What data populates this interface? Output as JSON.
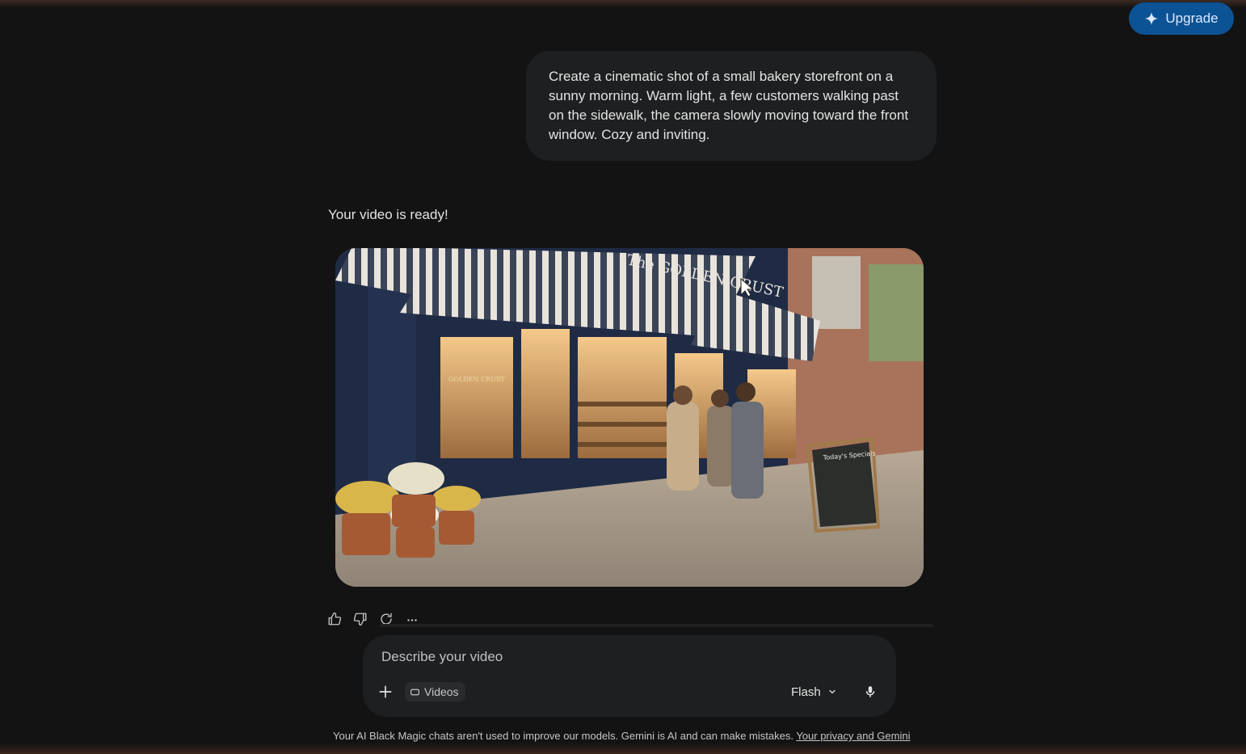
{
  "header": {
    "upgrade_label": "Upgrade"
  },
  "conversation": {
    "user_prompt": "Create a cinematic shot of a small bakery storefront on a sunny morning. Warm light, a few customers walking past on the sidewalk, the camera slowly moving toward the front window. Cozy and inviting.",
    "reply_text": "Your video is ready!",
    "video": {
      "storefront_sign": "The GOLDEN CRUST",
      "window_logo": "GOLDEN CRUST",
      "chalkboard_title": "Today's Specials"
    },
    "actions": [
      "thumbs-up",
      "thumbs-down",
      "regenerate",
      "more"
    ]
  },
  "composer": {
    "placeholder": "Describe your video",
    "chip_label": "Videos",
    "model_label": "Flash"
  },
  "footer": {
    "disclaimer": "Your AI Black Magic chats aren't used to improve our models. Gemini is AI and can make mistakes. ",
    "privacy_link": "Your privacy and Gemini"
  },
  "colors": {
    "background": "#131314",
    "surface": "#1e1f20",
    "upgrade": "#0b5394"
  }
}
